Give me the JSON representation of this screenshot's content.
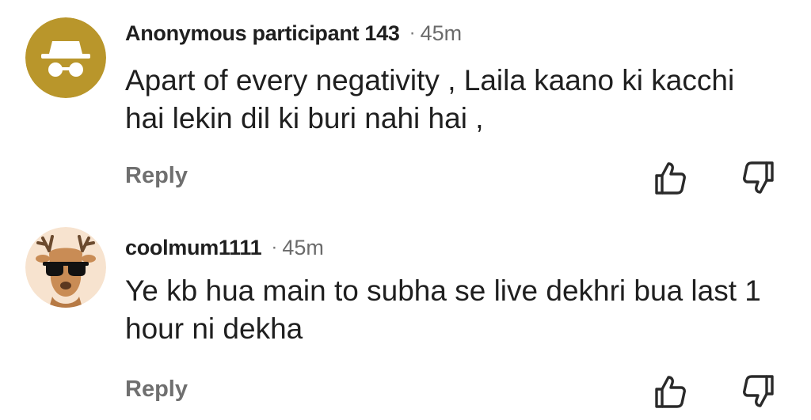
{
  "comments": [
    {
      "author": "Anonymous participant 143",
      "separator": "·",
      "time": "45m",
      "text": "Apart of every negativity , Laila kaano ki kacchi hai lekin dil ki buri nahi hai ,",
      "reply_label": "Reply",
      "avatar_icon": "incognito-icon",
      "avatar_bg": "#b9962b"
    },
    {
      "author": "coolmum1111",
      "separator": "·",
      "time": "45m",
      "text": "Ye kb hua main to subha se live dekhri bua last 1 hour ni dekha",
      "reply_label": "Reply",
      "avatar_icon": "deer-sunglasses-icon",
      "avatar_bg": "#f7e3cf"
    }
  ],
  "icons": {
    "like": "thumbs-up-icon",
    "dislike": "thumbs-down-icon"
  },
  "colors": {
    "text": "#1f1f1f",
    "muted": "#6f6f6f",
    "gold": "#b9962b"
  }
}
